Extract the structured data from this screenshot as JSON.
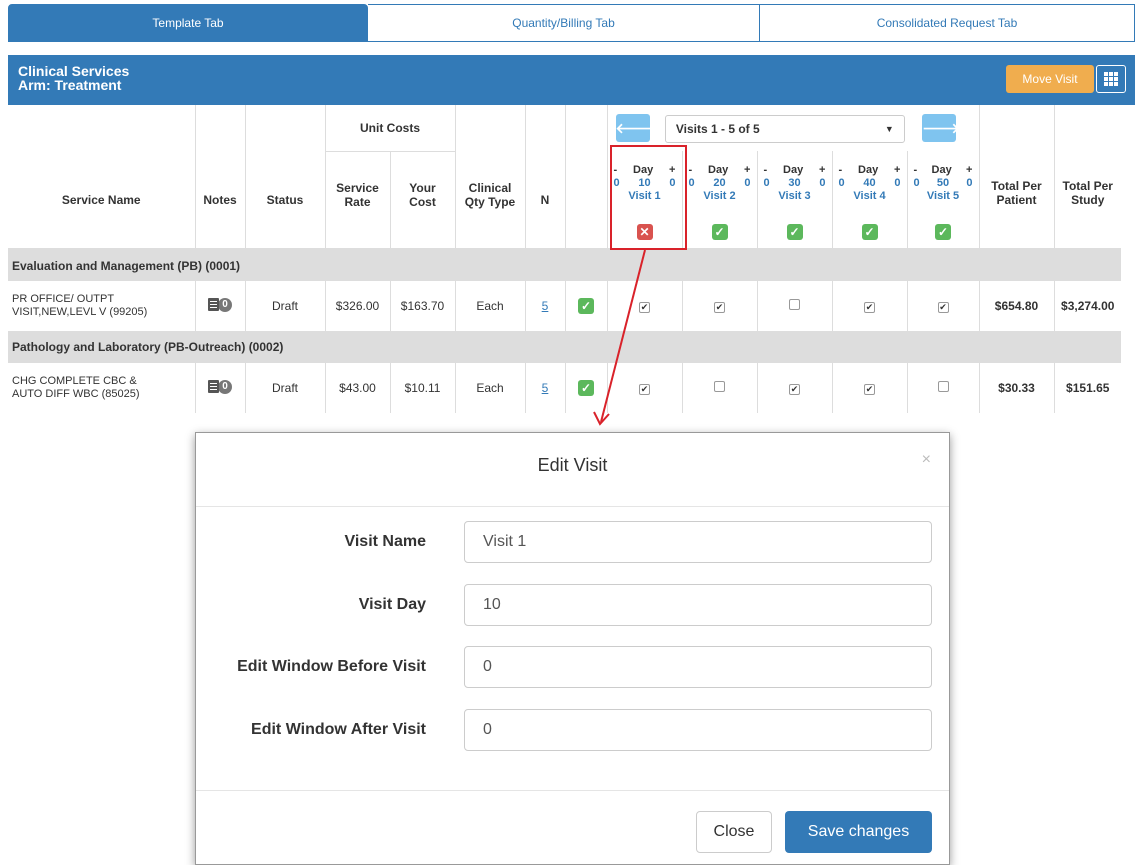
{
  "tabs": [
    "Template Tab",
    "Quantity/Billing Tab",
    "Consolidated Request Tab"
  ],
  "panel": {
    "title": "Clinical Services",
    "subtitle": "Arm: Treatment",
    "move_visit": "Move Visit"
  },
  "headers": {
    "service_name": "Service Name",
    "notes": "Notes",
    "status": "Status",
    "unit_costs": "Unit Costs",
    "service_rate_1": "Service",
    "service_rate_2": "Rate",
    "your_cost_1": "Your",
    "your_cost_2": "Cost",
    "clinical_1": "Clinical",
    "clinical_2": "Qty Type",
    "n": "N",
    "total_patient_1": "Total Per",
    "total_patient_2": "Patient",
    "total_study_1": "Total Per",
    "total_study_2": "Study"
  },
  "visit_select": "Visits 1 - 5 of 5",
  "visits": [
    {
      "minus": "-",
      "day_label": "Day",
      "plus": "+",
      "before": "0",
      "day": "10",
      "after": "0",
      "name": "Visit 1"
    },
    {
      "minus": "-",
      "day_label": "Day",
      "plus": "+",
      "before": "0",
      "day": "20",
      "after": "0",
      "name": "Visit 2"
    },
    {
      "minus": "-",
      "day_label": "Day",
      "plus": "+",
      "before": "0",
      "day": "30",
      "after": "0",
      "name": "Visit 3"
    },
    {
      "minus": "-",
      "day_label": "Day",
      "plus": "+",
      "before": "0",
      "day": "40",
      "after": "0",
      "name": "Visit 4"
    },
    {
      "minus": "-",
      "day_label": "Day",
      "plus": "+",
      "before": "0",
      "day": "50",
      "after": "0",
      "name": "Visit 5"
    }
  ],
  "sections": [
    {
      "title": "Evaluation and Management (PB) (0001)",
      "row": {
        "name1": "PR OFFICE/ OUTPT",
        "name2": "VISIT,NEW,LEVL V (99205)",
        "notes_count": "0",
        "status": "Draft",
        "rate": "$326.00",
        "cost": "$163.70",
        "qty_type": "Each",
        "n": "5",
        "visit_checks": [
          true,
          true,
          false,
          true,
          true
        ],
        "total_patient": "$654.80",
        "total_study": "$3,274.00"
      }
    },
    {
      "title": "Pathology and Laboratory (PB-Outreach) (0002)",
      "row": {
        "name1": "CHG COMPLETE CBC &",
        "name2": "AUTO DIFF WBC (85025)",
        "notes_count": "0",
        "status": "Draft",
        "rate": "$43.00",
        "cost": "$10.11",
        "qty_type": "Each",
        "n": "5",
        "visit_checks": [
          true,
          false,
          true,
          true,
          false
        ],
        "total_patient": "$30.33",
        "total_study": "$151.65"
      }
    }
  ],
  "modal": {
    "title": "Edit Visit",
    "close_x": "×",
    "fields": [
      {
        "label": "Visit Name",
        "value": "Visit 1"
      },
      {
        "label": "Visit Day",
        "value": "10"
      },
      {
        "label": "Edit Window Before Visit",
        "value": "0"
      },
      {
        "label": "Edit Window After Visit",
        "value": "0"
      }
    ],
    "close_button": "Close",
    "save_button": "Save changes"
  },
  "colors": {
    "primary": "#337ab7",
    "warning": "#f0ad4e",
    "success": "#5cb85c",
    "danger": "#d9534f",
    "highlight": "#d9222a"
  }
}
